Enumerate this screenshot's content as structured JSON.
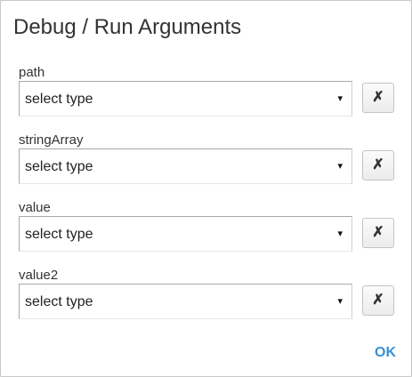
{
  "dialog": {
    "title": "Debug / Run Arguments",
    "ok_label": "OK",
    "accent_color": "#3a8fd4"
  },
  "arguments": [
    {
      "label": "path",
      "selected": "select type",
      "caret": "▾",
      "remove_glyph": "✗"
    },
    {
      "label": "stringArray",
      "selected": "select type",
      "caret": "▾",
      "remove_glyph": "✗"
    },
    {
      "label": "value",
      "selected": "select type",
      "caret": "▾",
      "remove_glyph": "✗"
    },
    {
      "label": "value2",
      "selected": "select type",
      "caret": "▾",
      "remove_glyph": "✗"
    }
  ],
  "icons": {
    "dropdown": "chevron-down-icon",
    "remove": "close-icon"
  }
}
